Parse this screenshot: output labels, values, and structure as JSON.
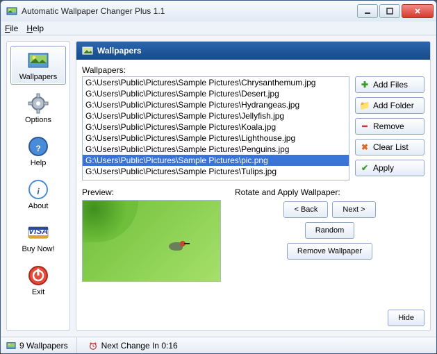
{
  "window": {
    "title": "Automatic Wallpaper Changer Plus 1.1"
  },
  "menu": {
    "file": "File",
    "help": "Help"
  },
  "sidebar": {
    "items": [
      {
        "label": "Wallpapers",
        "icon": "picture",
        "active": true
      },
      {
        "label": "Options",
        "icon": "gear",
        "active": false
      },
      {
        "label": "Help",
        "icon": "question",
        "active": false
      },
      {
        "label": "About",
        "icon": "info",
        "active": false
      },
      {
        "label": "Buy Now!",
        "icon": "visa",
        "active": false
      },
      {
        "label": "Exit",
        "icon": "power",
        "active": false
      }
    ]
  },
  "panel": {
    "title": "Wallpapers",
    "list_label": "Wallpapers:",
    "files": [
      {
        "path": "G:\\Users\\Public\\Pictures\\Sample Pictures\\Chrysanthemum.jpg",
        "selected": false
      },
      {
        "path": "G:\\Users\\Public\\Pictures\\Sample Pictures\\Desert.jpg",
        "selected": false
      },
      {
        "path": "G:\\Users\\Public\\Pictures\\Sample Pictures\\Hydrangeas.jpg",
        "selected": false
      },
      {
        "path": "G:\\Users\\Public\\Pictures\\Sample Pictures\\Jellyfish.jpg",
        "selected": false
      },
      {
        "path": "G:\\Users\\Public\\Pictures\\Sample Pictures\\Koala.jpg",
        "selected": false
      },
      {
        "path": "G:\\Users\\Public\\Pictures\\Sample Pictures\\Lighthouse.jpg",
        "selected": false
      },
      {
        "path": "G:\\Users\\Public\\Pictures\\Sample Pictures\\Penguins.jpg",
        "selected": false
      },
      {
        "path": "G:\\Users\\Public\\Pictures\\Sample Pictures\\pic.png",
        "selected": true
      },
      {
        "path": "G:\\Users\\Public\\Pictures\\Sample Pictures\\Tulips.jpg",
        "selected": false
      }
    ],
    "buttons": {
      "add_files": "Add Files",
      "add_folder": "Add Folder",
      "remove": "Remove",
      "clear_list": "Clear List",
      "apply": "Apply"
    },
    "preview_label": "Preview:",
    "rotate_label": "Rotate and Apply Wallpaper:",
    "rotate_buttons": {
      "back": "< Back",
      "next": "Next >",
      "random": "Random",
      "remove_wallpaper": "Remove Wallpaper"
    },
    "hide": "Hide"
  },
  "status": {
    "count": "9 Wallpapers",
    "next_change": "Next Change In 0:16"
  }
}
